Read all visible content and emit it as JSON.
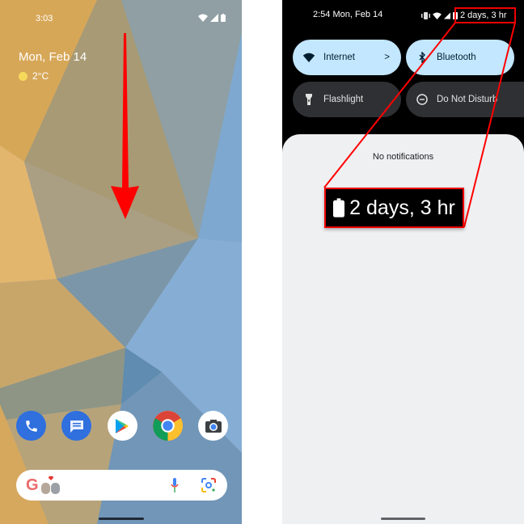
{
  "left_screen": {
    "status_time": "3:03",
    "status_icons": [
      "wifi-icon",
      "signal-icon",
      "battery-icon"
    ],
    "date": "Mon, Feb 14",
    "weather": {
      "icon": "sun-icon",
      "temp": "2°C"
    },
    "dock_apps": [
      {
        "name": "Phone",
        "icon": "phone-icon",
        "color": "#2f6fde"
      },
      {
        "name": "Messages",
        "icon": "messages-icon",
        "color": "#2f6fde"
      },
      {
        "name": "Play Store",
        "icon": "play-store-icon",
        "color": "#ffffff"
      },
      {
        "name": "Chrome",
        "icon": "chrome-icon",
        "color": "#ffffff"
      },
      {
        "name": "Camera",
        "icon": "camera-icon",
        "color": "#ffffff"
      }
    ],
    "search_bar": {
      "logo": "G",
      "mic_icon": "mic-icon",
      "lens_icon": "lens-icon"
    },
    "annotation": "swipe-down-arrow"
  },
  "right_screen": {
    "status_time_date": "2:54 Mon, Feb 14",
    "status_icons": [
      "vibrate-icon",
      "wifi-icon",
      "signal-icon",
      "battery-icon"
    ],
    "battery_text": "2 days, 3 hr",
    "tiles": [
      {
        "label": "Internet",
        "icon": "wifi-icon",
        "active": true,
        "chevron": ">"
      },
      {
        "label": "Bluetooth",
        "icon": "bluetooth-icon",
        "active": true
      },
      {
        "label": "Flashlight",
        "icon": "flashlight-icon",
        "active": false
      },
      {
        "label": "Do Not Disturb",
        "icon": "dnd-icon",
        "active": false
      }
    ],
    "notifications_text": "No notifications",
    "callout_text": "2 days, 3 hr"
  },
  "colors": {
    "tile_active": "#c3e7ff",
    "tile_inactive": "#2f3033",
    "annotation_red": "#ff0000"
  }
}
